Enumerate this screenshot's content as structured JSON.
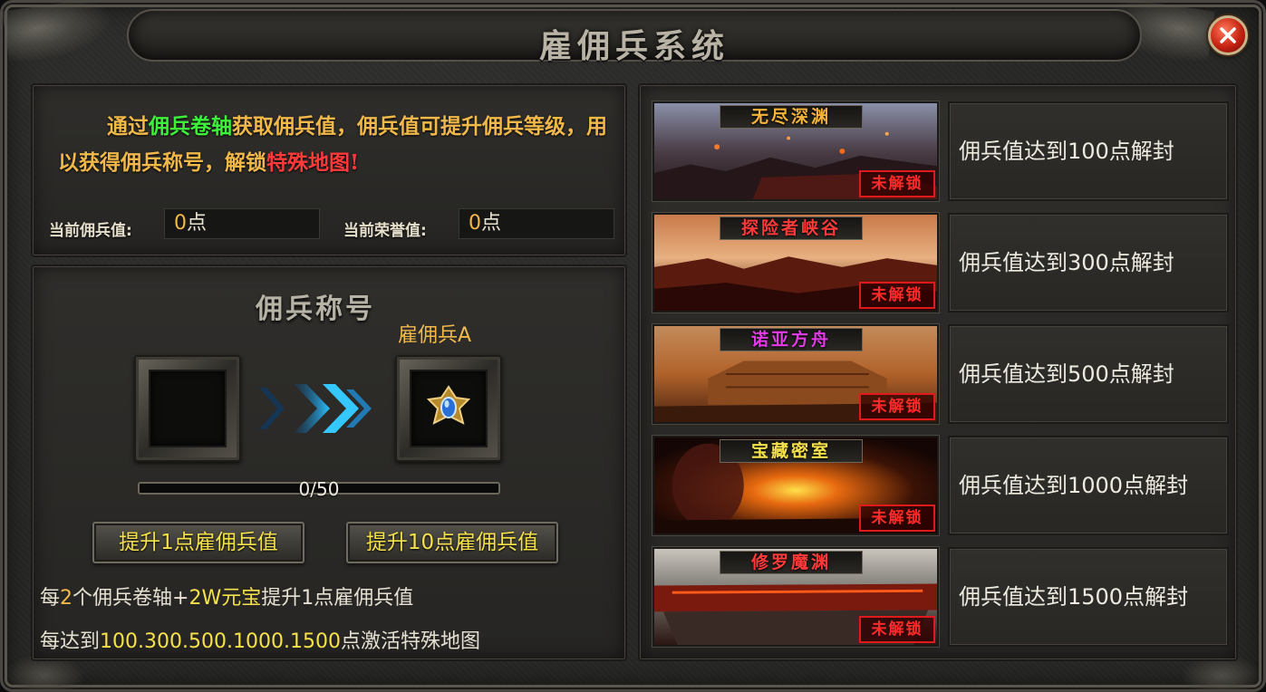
{
  "window": {
    "title": "雇佣兵系统"
  },
  "intro": {
    "p1": "通过",
    "p2": "佣兵卷轴",
    "p3": "获取佣兵值，佣兵值可提升佣兵等级，用以获得佣兵称号，解锁",
    "p4": "特殊地图",
    "p5": "!"
  },
  "stats": {
    "mercenary_label": "当前佣兵值:",
    "mercenary_value": "0",
    "honor_label": "当前荣誉值:",
    "honor_value": "0",
    "unit": "点"
  },
  "title_section": {
    "heading": "佣兵称号",
    "next_rank_name": "雇佣兵A",
    "progress": {
      "current": 0,
      "max": 50,
      "text": "0/50"
    }
  },
  "buttons": {
    "add_one": "提升1点雇佣兵值",
    "add_ten": "提升10点雇佣兵值"
  },
  "notes": {
    "line1_a": "每",
    "line1_b": "2",
    "line1_c": "个佣兵卷轴+",
    "line1_d": "2W元宝",
    "line1_e": "提升1点雇佣兵值",
    "line2_a": "每达到",
    "line2_b": "100.300.500.1000.1500",
    "line2_c": "点激活特殊地图"
  },
  "maps": [
    {
      "name": "无尽深渊",
      "name_color": "#f5b43a",
      "status": "未解锁",
      "requirement": "佣兵值达到100点解封"
    },
    {
      "name": "探险者峡谷",
      "name_color": "#ff3a3a",
      "status": "未解锁",
      "requirement": "佣兵值达到300点解封"
    },
    {
      "name": "诺亚方舟",
      "name_color": "#e43ae8",
      "status": "未解锁",
      "requirement": "佣兵值达到500点解封"
    },
    {
      "name": "宝藏密室",
      "name_color": "#f5e14a",
      "status": "未解锁",
      "requirement": "佣兵值达到1000点解封"
    },
    {
      "name": "修罗魔渊",
      "name_color": "#ff3a3a",
      "status": "未解锁",
      "requirement": "佣兵值达到1500点解封"
    }
  ],
  "icons": {
    "close": "close-icon",
    "arrow": "chevron-right-icon",
    "rank_badge": "rank-emblem-icon"
  }
}
